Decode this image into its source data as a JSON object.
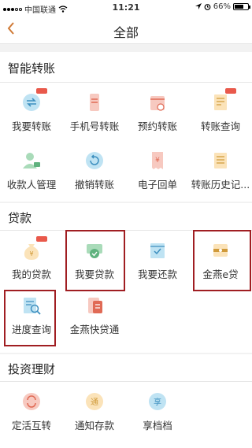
{
  "status": {
    "carrier": "中国联通",
    "time": "11:21",
    "battery": "66%",
    "battery_fraction": 0.66
  },
  "nav": {
    "title": "全部"
  },
  "sections": [
    {
      "title": "智能转账",
      "items": [
        "我要转账",
        "手机号转账",
        "预约转账",
        "转账查询",
        "收款人管理",
        "撤销转账",
        "电子回单",
        "转账历史记..."
      ]
    },
    {
      "title": "贷款",
      "items": [
        "我的贷款",
        "我要贷款",
        "我要还款",
        "金燕e贷",
        "进度查询",
        "金燕快贷通"
      ]
    },
    {
      "title": "投资理财",
      "items": [
        "定活互转",
        "通知存款",
        "享档档"
      ]
    }
  ],
  "icons": {
    "transfer": "transfer-icon",
    "phone": "phone-transfer-icon",
    "calendar": "scheduled-transfer-icon",
    "document": "transfer-query-icon",
    "user": "payee-manage-icon",
    "undo": "cancel-transfer-icon",
    "receipt": "receipt-icon",
    "history": "history-icon"
  },
  "colors": {
    "accent": "#d07a36",
    "highlight": "#a01e22",
    "badge": "#e9594b"
  },
  "highlighted_items": [
    "我要贷款",
    "金燕e贷",
    "进度查询"
  ]
}
